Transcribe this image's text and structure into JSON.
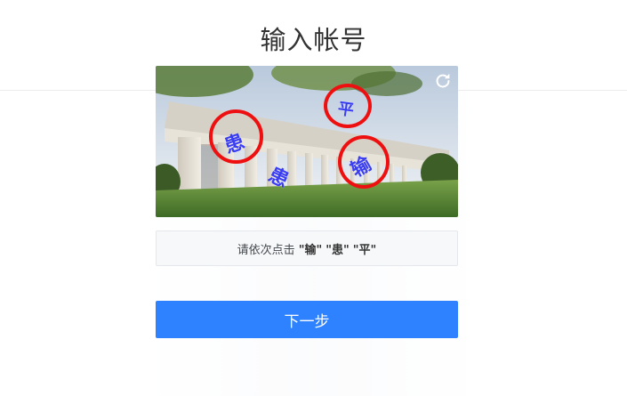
{
  "page": {
    "title": "输入帐号"
  },
  "captcha": {
    "refresh_icon": "refresh-icon",
    "characters": [
      {
        "text": "患",
        "circled": true
      },
      {
        "text": "平",
        "circled": true
      },
      {
        "text": "输",
        "circled": true
      },
      {
        "text": "患",
        "circled": false
      }
    ]
  },
  "instruction": {
    "prefix": "请依次点击",
    "targets": [
      "\"输\"",
      "\"患\"",
      "\"平\""
    ]
  },
  "next_button": {
    "label": "下一步",
    "color": "#2e82ff"
  },
  "colors": {
    "ring": "#ee1010",
    "char": "#3a3df0"
  }
}
